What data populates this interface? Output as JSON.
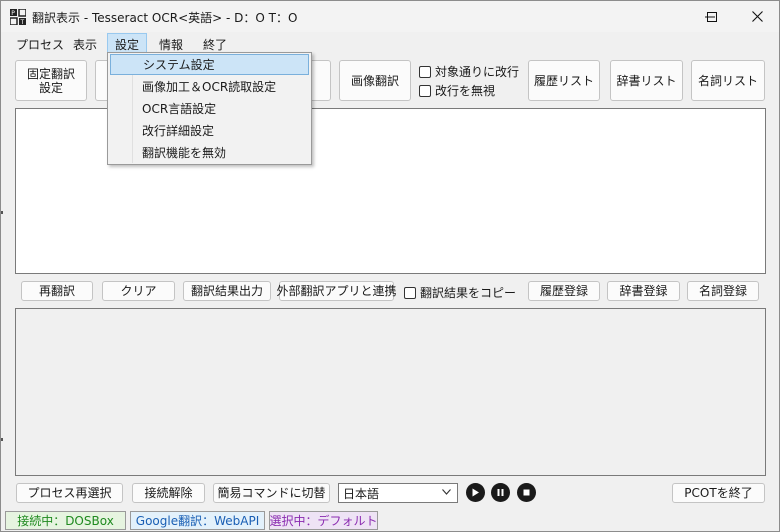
{
  "window": {
    "title": "翻訳表示 - Tesseract OCR<英語> - D：O T：O",
    "controls": [
      "minimize-icon",
      "maximize-icon",
      "close-icon"
    ]
  },
  "menu": {
    "items": [
      "プロセス",
      "表示",
      "設定",
      "情報",
      "終了"
    ],
    "active": "設定"
  },
  "settings_menu": {
    "items": [
      "システム設定",
      "画像加工＆OCR読取設定",
      "OCR言語設定",
      "改行詳細設定",
      "翻訳機能を無効"
    ],
    "highlighted": "システム設定"
  },
  "toolbar": {
    "fixed_translation": "固定翻訳\n設定",
    "image_translation": "画像翻訳",
    "break_per_target": "対象通りに改行",
    "ignore_breaks": "改行を無視",
    "history_list": "履歴リスト",
    "dictionary_list": "辞書リスト",
    "noun_list": "名詞リスト"
  },
  "actions": {
    "retranslate": "再翻訳",
    "clear": "クリア",
    "output_result": "翻訳結果出力",
    "external_app": "外部翻訳アプリと連携",
    "copy_result": "翻訳結果をコピー",
    "register_history": "履歴登録",
    "register_dictionary": "辞書登録",
    "register_noun": "名詞登録"
  },
  "bottom": {
    "reselect_process": "プロセス再選択",
    "disconnect": "接続解除",
    "simple_command": "簡易コマンドに切替",
    "language": "日本語",
    "exit": "PCOTを終了"
  },
  "status": {
    "connected": "接続中：DOSBox",
    "translator": "Google翻訳：WebAPI",
    "selected": "選択中：デフォルト"
  },
  "colors": {
    "status_connected_bg": "#e6f4e0",
    "status_connected_fg": "#1f8a1f",
    "status_translator_bg": "#e3f1fb",
    "status_translator_fg": "#1a5fb4",
    "status_selected_bg": "#eee3f5",
    "status_selected_fg": "#8a2bb0",
    "menu_highlight": "#cce4f7"
  }
}
